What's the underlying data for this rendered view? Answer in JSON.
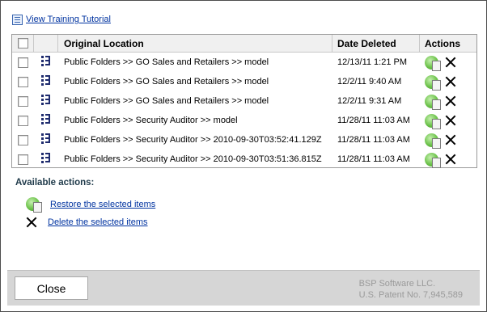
{
  "tutorial": {
    "label": "View Training Tutorial",
    "icon": "tutorial-icon"
  },
  "grid": {
    "columns": {
      "location": "Original Location",
      "date": "Date Deleted",
      "actions": "Actions"
    },
    "rows": [
      {
        "location": "Public Folders >> GO Sales and Retailers >> model",
        "date": "12/13/11 1:21 PM",
        "checked": false
      },
      {
        "location": "Public Folders >> GO Sales and Retailers >> model",
        "date": "12/2/11 9:40 AM",
        "checked": false
      },
      {
        "location": "Public Folders >> GO Sales and Retailers >> model",
        "date": "12/2/11 9:31 AM",
        "checked": false
      },
      {
        "location": "Public Folders >> Security Auditor >> model",
        "date": "11/28/11 11:03 AM",
        "checked": false
      },
      {
        "location": "Public Folders >> Security Auditor >> 2010-09-30T03:52:41.129Z",
        "date": "11/28/11 11:03 AM",
        "checked": false
      },
      {
        "location": "Public Folders >> Security Auditor >> 2010-09-30T03:51:36.815Z",
        "date": "11/28/11 11:03 AM",
        "checked": false
      }
    ]
  },
  "available_actions": {
    "title": "Available actions:",
    "restore_label": "Restore the selected items",
    "delete_label": "Delete the selected items"
  },
  "footer": {
    "close_label": "Close",
    "vendor_line1": "BSP Software LLC.",
    "vendor_line2": "U.S. Patent No. 7,945,589"
  },
  "colors": {
    "link": "#0033a0",
    "footer_bg": "#d6d6d6",
    "header_bg": "#f0f0f0",
    "actions_title": "#1f3a4a"
  }
}
